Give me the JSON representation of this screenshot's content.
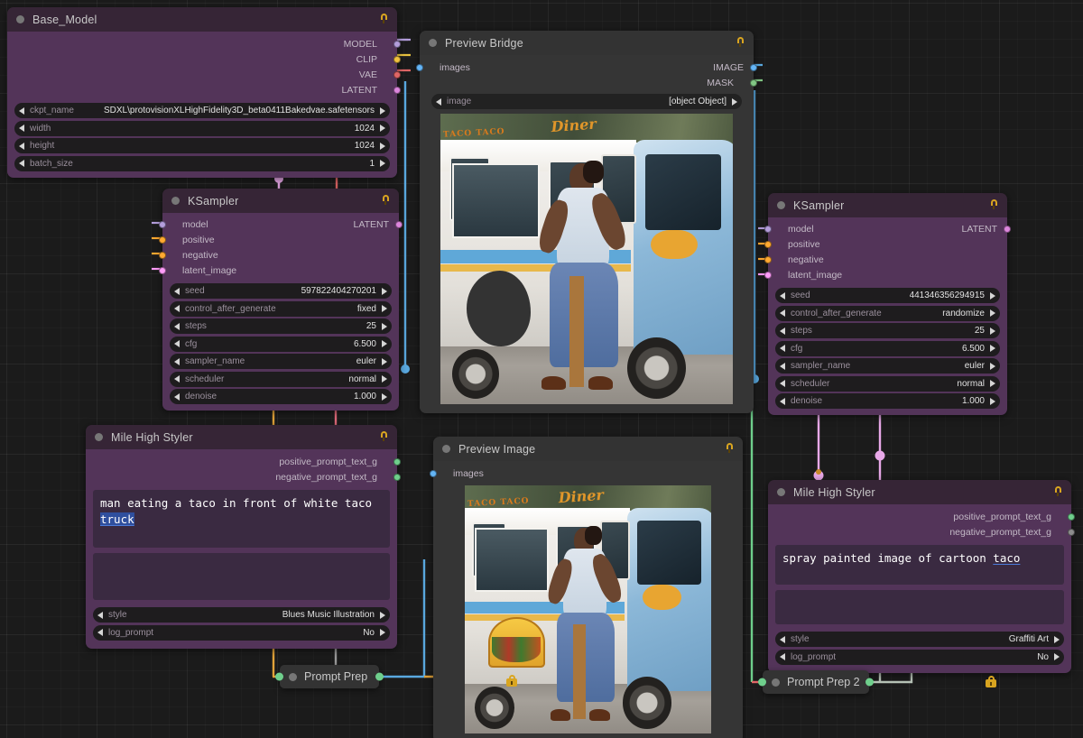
{
  "canvas": {
    "background": "#1b1b1b",
    "grid": true
  },
  "colors": {
    "node_purple_header": "#362536",
    "node_purple_body": "#533459",
    "node_gray_header": "#333333",
    "node_gray_body": "#353535",
    "slot_model": "#b39ddb",
    "slot_clip": "#f0c040",
    "slot_vae": "#e06666",
    "slot_latent": "#ff9cf9",
    "slot_conditioning": "#ffa931",
    "slot_image": "#64b5f6",
    "slot_mask": "#81c784",
    "slot_string": "#6fcf8c",
    "text_accent": "#4c7bd9"
  },
  "nodes": {
    "base_model": {
      "title": "Base_Model",
      "locked": true,
      "outputs": [
        {
          "label": "MODEL",
          "color": "#b39ddb"
        },
        {
          "label": "CLIP",
          "color": "#f0c040"
        },
        {
          "label": "VAE",
          "color": "#e06666"
        },
        {
          "label": "LATENT",
          "color": "#dd86dd"
        }
      ],
      "widgets": [
        {
          "name": "ckpt_name",
          "value": "SDXL\\protovisionXLHighFidelity3D_beta0411Bakedvae.safetensors"
        },
        {
          "name": "width",
          "value": "1024"
        },
        {
          "name": "height",
          "value": "1024"
        },
        {
          "name": "batch_size",
          "value": "1"
        }
      ]
    },
    "ksampler_left": {
      "title": "KSampler",
      "locked": true,
      "inputs": [
        {
          "label": "model",
          "color": "#b39ddb"
        },
        {
          "label": "positive",
          "color": "#ffa931"
        },
        {
          "label": "negative",
          "color": "#ffa931"
        },
        {
          "label": "latent_image",
          "color": "#ff9cf9"
        }
      ],
      "outputs": [
        {
          "label": "LATENT",
          "color": "#dd86dd"
        }
      ],
      "widgets": [
        {
          "name": "seed",
          "value": "597822404270201"
        },
        {
          "name": "control_after_generate",
          "value": "fixed"
        },
        {
          "name": "steps",
          "value": "25"
        },
        {
          "name": "cfg",
          "value": "6.500"
        },
        {
          "name": "sampler_name",
          "value": "euler"
        },
        {
          "name": "scheduler",
          "value": "normal"
        },
        {
          "name": "denoise",
          "value": "1.000"
        }
      ]
    },
    "ksampler_right": {
      "title": "KSampler",
      "locked": true,
      "inputs": [
        {
          "label": "model",
          "color": "#b39ddb"
        },
        {
          "label": "positive",
          "color": "#ffa931"
        },
        {
          "label": "negative",
          "color": "#ffa931"
        },
        {
          "label": "latent_image",
          "color": "#ff9cf9"
        }
      ],
      "outputs": [
        {
          "label": "LATENT",
          "color": "#dd86dd"
        }
      ],
      "widgets": [
        {
          "name": "seed",
          "value": "441346356294915"
        },
        {
          "name": "control_after_generate",
          "value": "randomize"
        },
        {
          "name": "steps",
          "value": "25"
        },
        {
          "name": "cfg",
          "value": "6.500"
        },
        {
          "name": "sampler_name",
          "value": "euler"
        },
        {
          "name": "scheduler",
          "value": "normal"
        },
        {
          "name": "denoise",
          "value": "1.000"
        }
      ]
    },
    "styler_left": {
      "title": "Mile High Styler",
      "locked": true,
      "outputs": [
        {
          "label": "positive_prompt_text_g",
          "color": "#6fcf8c"
        },
        {
          "label": "negative_prompt_text_g",
          "color": "#6fcf8c"
        }
      ],
      "prompt_positive_prefix": "man eating a taco in front of white taco ",
      "prompt_positive_misspelled": "truck",
      "prompt_negative": "",
      "widgets": [
        {
          "name": "style",
          "value": "Blues Music Illustration"
        },
        {
          "name": "log_prompt",
          "value": "No"
        }
      ]
    },
    "styler_right": {
      "title": "Mile High Styler",
      "locked": true,
      "outputs": [
        {
          "label": "positive_prompt_text_g",
          "color": "#6fcf8c"
        },
        {
          "label": "negative_prompt_text_g",
          "color": "#8d8d8d"
        }
      ],
      "prompt_positive_prefix": "spray painted image of cartoon ",
      "prompt_positive_misspelled": "taco",
      "prompt_negative": "",
      "widgets": [
        {
          "name": "style",
          "value": "Graffiti Art"
        },
        {
          "name": "log_prompt",
          "value": "No"
        }
      ]
    },
    "preview_bridge": {
      "title": "Preview Bridge",
      "locked": true,
      "inputs": [
        {
          "label": "images",
          "color": "#64b5f6"
        }
      ],
      "outputs": [
        {
          "label": "IMAGE",
          "color": "#64b5f6"
        },
        {
          "label": "MASK",
          "color": "#81c784"
        }
      ],
      "widgets": [
        {
          "name": "image",
          "value": "[object Object]"
        }
      ],
      "image_caption_top": "TACO TACO",
      "image_caption_script": "Diner"
    },
    "preview_image": {
      "title": "Preview Image",
      "locked": true,
      "inputs": [
        {
          "label": "images",
          "color": "#64b5f6"
        }
      ],
      "image_caption_top": "TACO TACO",
      "image_caption_script": "Diner"
    },
    "prompt_prep": {
      "title": "Prompt Prep",
      "collapsed": true
    },
    "prompt_prep_2": {
      "title": "Prompt Prep 2",
      "collapsed": true
    }
  }
}
